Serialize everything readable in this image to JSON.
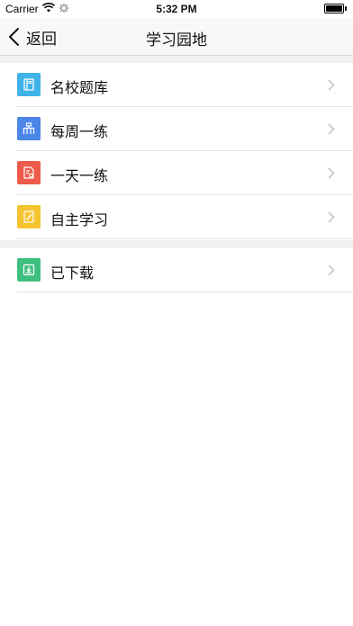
{
  "status_bar": {
    "carrier": "Carrier",
    "time": "5:32 PM"
  },
  "nav": {
    "back_label": "返回",
    "title": "学习园地"
  },
  "sections": [
    {
      "items": [
        {
          "label": "名校题库",
          "icon": "book-icon",
          "color": "#3fb2e8"
        },
        {
          "label": "每周一练",
          "icon": "calendar-icon",
          "color": "#4c86e8"
        },
        {
          "label": "一天一练",
          "icon": "clipboard-icon",
          "color": "#ee5b4a"
        },
        {
          "label": "自主学习",
          "icon": "pencil-note-icon",
          "color": "#f5c531"
        }
      ]
    },
    {
      "items": [
        {
          "label": "已下载",
          "icon": "download-icon",
          "color": "#3fbf7f"
        }
      ]
    }
  ]
}
